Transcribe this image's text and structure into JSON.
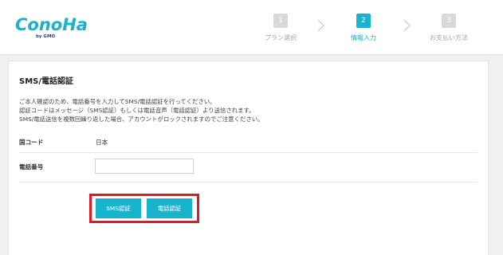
{
  "brand": {
    "name": "ConoHa",
    "sub": "by GMO",
    "color": "#18b3cc"
  },
  "steps": [
    {
      "number": "1",
      "label": "プラン選択",
      "state": "inactive"
    },
    {
      "number": "2",
      "label": "情報入力",
      "state": "active"
    },
    {
      "number": "3",
      "label": "お支払い方法",
      "state": "inactive"
    }
  ],
  "section": {
    "title": "SMS/電話認証",
    "description": [
      "ご本人確認のため、電話番号を入力してSMS/電話認証を行ってください。",
      "認証コードはメッセージ（SMS認証）もしくは電話音声（電話認証）より送信されます。",
      "SMS/電話送信を複数回繰り返した場合、アカウントがロックされますのでご注意ください。"
    ]
  },
  "form": {
    "country_label": "国コード",
    "country_value": "日本",
    "phone_label": "電話番号",
    "phone_value": "",
    "phone_placeholder": ""
  },
  "buttons": {
    "sms": "SMS認証",
    "phone": "電話認証"
  },
  "colors": {
    "accent": "#18b3cc",
    "highlight": "#e0192b",
    "inactive_step": "#d7dadd",
    "background": "#eef0f2"
  }
}
